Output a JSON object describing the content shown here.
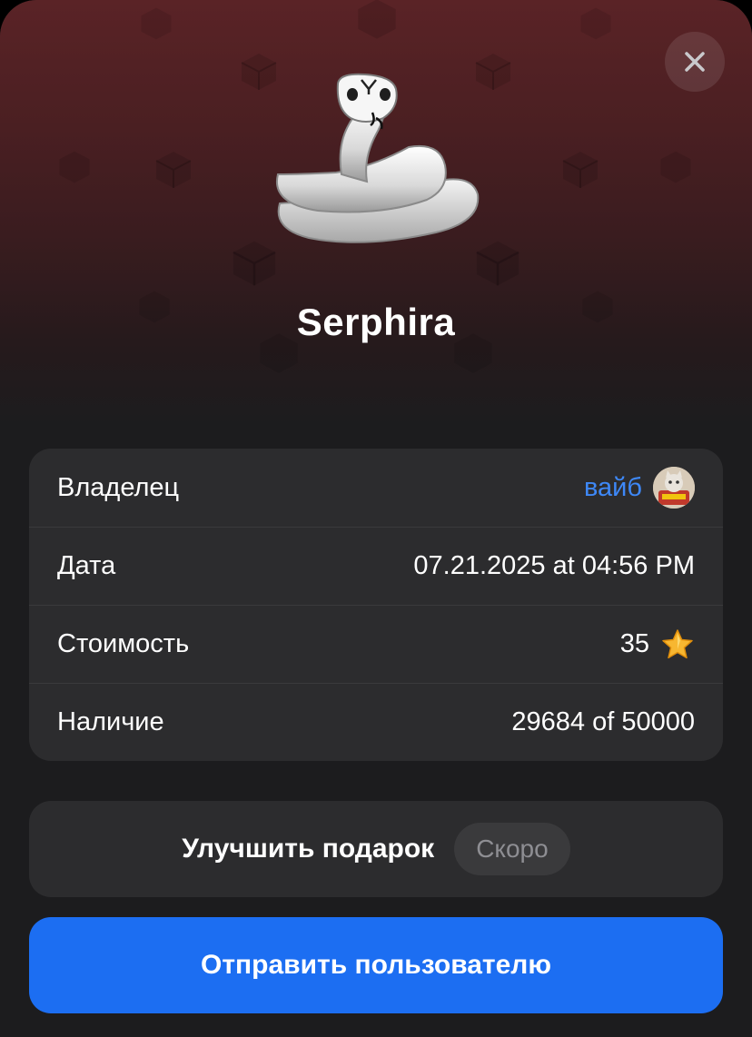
{
  "gift": {
    "name": "Serphira",
    "image": "white-snake-sticker"
  },
  "details": {
    "owner_label": "Владелец",
    "owner_name": "вайб",
    "owner_avatar": "cat-avatar",
    "date_label": "Дата",
    "date_value": "07.21.2025 at 04:56 PM",
    "price_label": "Стоимость",
    "price_value": "35",
    "price_icon": "star-icon",
    "availability_label": "Наличие",
    "availability_value": "29684 of 50000"
  },
  "actions": {
    "upgrade_label": "Улучшить подарок",
    "upgrade_badge": "Скоро",
    "send_label": "Отправить пользователю",
    "close_icon": "close-icon"
  },
  "colors": {
    "hero_top": "#5a2326",
    "sheet_bg": "#1c1c1e",
    "card_bg": "#2c2c2e",
    "link": "#3e88f7",
    "primary_button": "#1c6ef2",
    "star": "#f7b731"
  }
}
